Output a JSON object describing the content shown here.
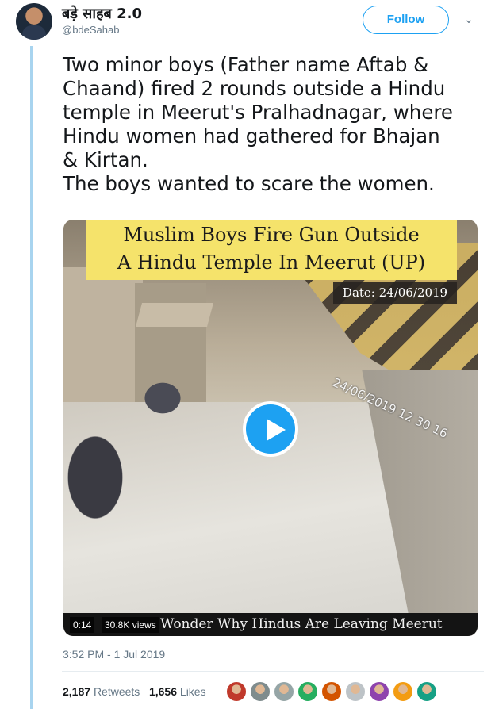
{
  "user": {
    "display_name": "बड़े साहब 2.0",
    "handle": "@bdeSahab"
  },
  "follow_label": "Follow",
  "caret_icon": "chevron-down-icon",
  "tweet": {
    "text_lines": [
      "Two minor boys (Father name Aftab &",
      "Chaand) fired 2 rounds outside a Hindu",
      "temple in Meerut's Pralhadnagar, where",
      "Hindu women had gathered for Bhajan",
      "& Kirtan.",
      "The boys wanted to scare the women."
    ]
  },
  "video": {
    "headline_line1": "Muslim Boys Fire Gun Outside",
    "headline_line2": "A Hindu Temple In Meerut (UP)",
    "date": "Date: 24/06/2019",
    "cctv_stamp": "24/06/2019 12 30 16",
    "time": "0:14",
    "views": "30.8K views",
    "caption": "Wonder Why Hindus Are Leaving Meerut",
    "play_icon": "play-icon"
  },
  "timestamp": "3:52 PM - 1 Jul 2019",
  "stats": {
    "retweets_count": "2,187",
    "retweets_label": "Retweets",
    "likes_count": "1,656",
    "likes_label": "Likes"
  },
  "liker_colors": [
    "#c0392b",
    "#7f8c8d",
    "#95a5a6",
    "#27ae60",
    "#d35400",
    "#bdc3c7",
    "#8e44ad",
    "#f39c12",
    "#16a085"
  ],
  "colors": {
    "accent": "#1da1f2",
    "text": "#14171a",
    "muted": "#657786"
  }
}
